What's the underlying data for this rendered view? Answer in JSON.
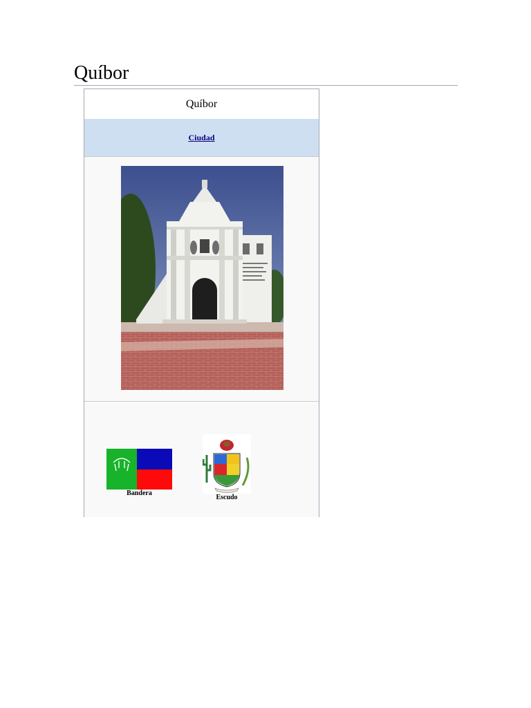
{
  "article": {
    "title": "Quíbor"
  },
  "infobox": {
    "name": "Quíbor",
    "type_link": "Ciudad",
    "photo_icon": "church-photo",
    "flag_label": "Bandera",
    "coat_label": "Escudo",
    "colors": {
      "flag_green": "#17b32a",
      "flag_blue": "#0a0ab8",
      "flag_red": "#ff0a0a",
      "header_bg": "#cedff2",
      "link": "#0b0080"
    }
  }
}
